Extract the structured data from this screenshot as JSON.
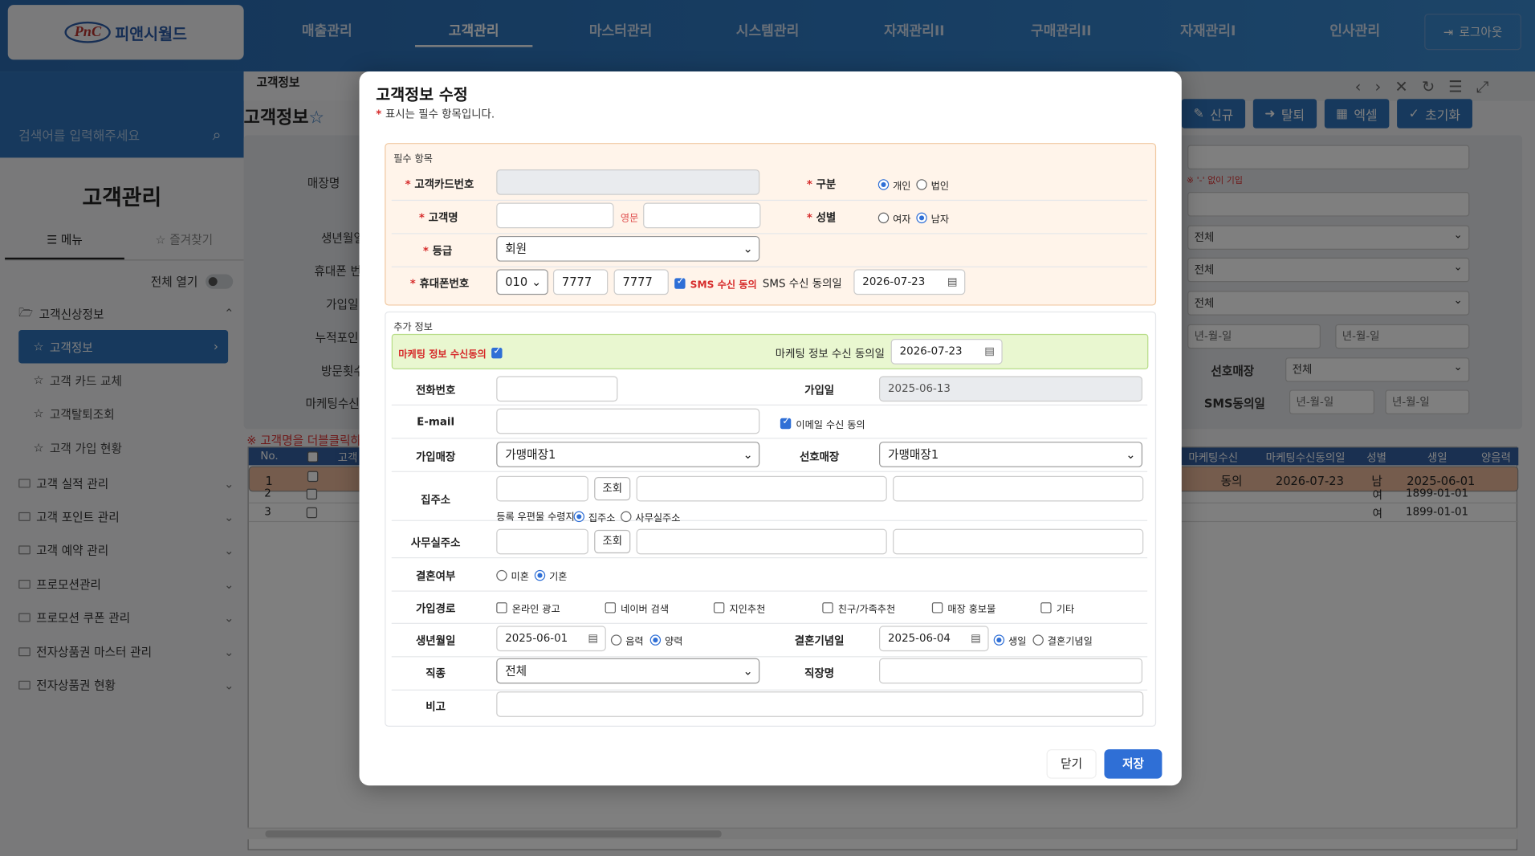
{
  "app": {
    "logo_mark": "PnC",
    "logo_text": "피앤시월드",
    "logout": "로그아웃"
  },
  "topnav": [
    "매출관리",
    "고객관리",
    "마스터관리",
    "시스템관리",
    "자재관리II",
    "구매관리II",
    "자재관리I",
    "인사관리"
  ],
  "sidebar": {
    "search_placeholder": "검색어를 입력해주세요",
    "title": "고객관리",
    "tab_menu": "메뉴",
    "tab_fav": "즐겨찾기",
    "open_all": "전체 열기",
    "group_open": "고객신상정보",
    "sub_items": [
      "고객정보",
      "고객 카드 교체",
      "고객탈퇴조회",
      "고객 가입 현황"
    ],
    "groups": [
      "고객 실적 관리",
      "고객 포인트 관리",
      "고객 예약 관리",
      "프로모션관리",
      "프로모션 쿠폰 관리",
      "전자상품권 마스터 관리",
      "전자상품권 현황"
    ]
  },
  "main": {
    "page_tab": "고객정보",
    "page_title": "고객정보",
    "buttons": [
      "신규",
      "탈퇴",
      "엑셀",
      "초기화"
    ],
    "filter_labels": [
      "매장명",
      "생년월일",
      "휴대폰 번",
      "가입일",
      "누적포인",
      "방문횟수",
      "마케팅수신"
    ],
    "filter_note": "※ '-' 없이 기입",
    "right_selects": [
      "전체",
      "전체",
      "전체"
    ],
    "date_placeholder": "년-월-일",
    "pref_store_label": "선호매장",
    "pref_store_value": "전체",
    "sms_label": "SMS동의일",
    "grid_note": "※ 고객명을 더블클릭하시",
    "grid_headers_left": [
      "No.",
      "고객"
    ],
    "grid_headers_right": [
      "마케팅수신",
      "마케팅수신동의일",
      "성별",
      "생일",
      "양음력"
    ],
    "rows": [
      {
        "no": "1",
        "mkt": "동의",
        "mkt_date": "2026-07-23",
        "gender": "남",
        "birth": "2025-06-01"
      },
      {
        "no": "2",
        "mkt": "",
        "mkt_date": "",
        "gender": "여",
        "birth": "1899-01-01"
      },
      {
        "no": "3",
        "mkt": "",
        "mkt_date": "",
        "gender": "여",
        "birth": "1899-01-01"
      }
    ]
  },
  "modal": {
    "title": "고객정보 수정",
    "required_note": "표시는 필수 항목입니다.",
    "section_required": "필수 항목",
    "section_extra": "추가 정보",
    "card_no_label": "고객카드번호",
    "type_label": "구분",
    "type_options": [
      "개인",
      "법인"
    ],
    "name_label": "고객명",
    "eng_label": "영문",
    "gender_label": "성별",
    "gender_options": [
      "여자",
      "남자"
    ],
    "grade_label": "등급",
    "grade_value": "회원",
    "phone_label": "휴대폰번호",
    "phone_prefix": "010",
    "phone_mid": "7777",
    "phone_last": "7777",
    "sms_consent": "SMS 수신 동의",
    "sms_date_label": "SMS 수신 동의일",
    "sms_date": "2026-07-23",
    "mkt_consent": "마케팅 정보 수신동의",
    "mkt_date_label": "마케팅 정보 수신 동의일",
    "mkt_date": "2026-07-23",
    "tel_label": "전화번호",
    "join_label": "가입일",
    "join_date": "2025-06-13",
    "email_label": "E-mail",
    "email_consent": "이메일 수신 동의",
    "join_store_label": "가입매장",
    "join_store": "가맹매장1",
    "pref_store_label": "선호매장",
    "pref_store": "가맹매장1",
    "home_addr_label": "집주소",
    "lookup": "조회",
    "mail_recv_label": "등록 우편물 수령지",
    "mail_options": [
      "집주소",
      "사무실주소"
    ],
    "office_addr_label": "사무실주소",
    "married_label": "결혼여부",
    "married_options": [
      "미혼",
      "기혼"
    ],
    "route_label": "가입경로",
    "routes": [
      "온라인 광고",
      "네이버 검색",
      "지인추천",
      "친구/가족추천",
      "매장 홍보물",
      "기타"
    ],
    "birth_label": "생년월일",
    "birth_date": "2025-06-01",
    "lunar_options": [
      "음력",
      "양력"
    ],
    "anniv_label": "결혼기념일",
    "anniv_date": "2025-06-04",
    "anniv_options": [
      "생일",
      "결혼기념일"
    ],
    "job_label": "직종",
    "job_value": "전체",
    "company_label": "직장명",
    "memo_label": "비고",
    "close": "닫기",
    "save": "저장"
  }
}
